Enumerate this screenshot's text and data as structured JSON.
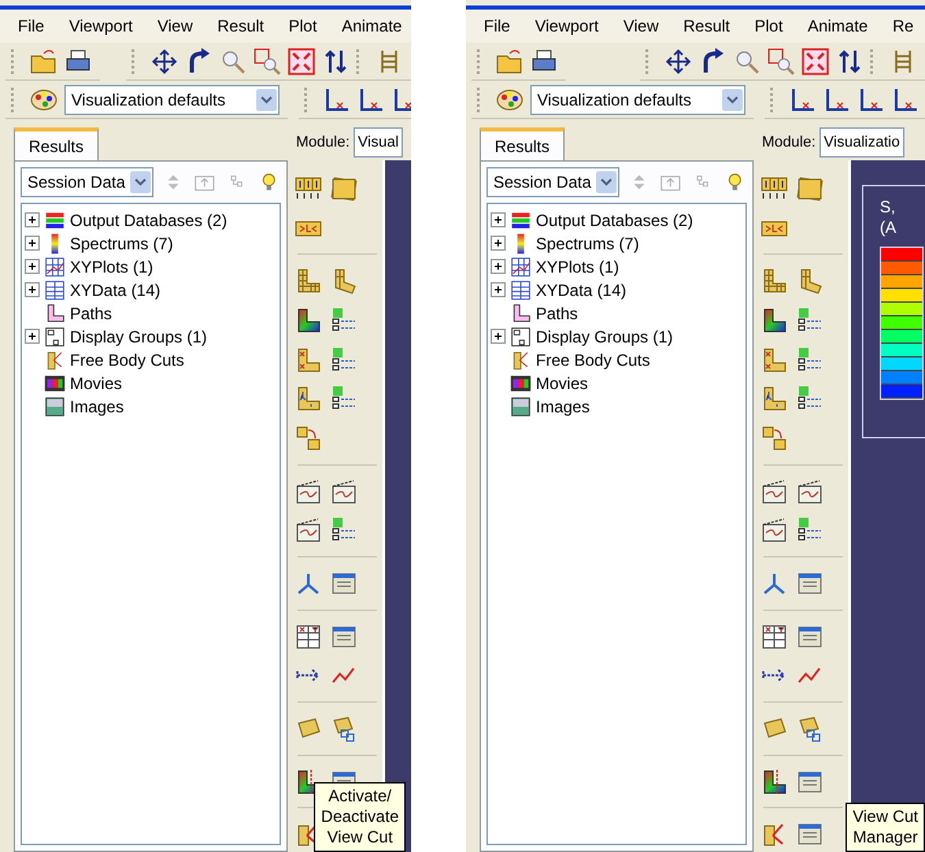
{
  "panels": [
    {
      "menu": [
        "File",
        "Viewport",
        "View",
        "Result",
        "Plot",
        "Animate"
      ],
      "style_combo": "Visualization defaults",
      "tabs": [
        {
          "label": "Results",
          "selected": true
        }
      ],
      "session_combo": "Session Data",
      "module_label": "Module:",
      "module_value": "Visual",
      "tree": [
        {
          "label": "Output Databases (2)",
          "kind": "odb",
          "expandable": true
        },
        {
          "label": "Spectrums (7)",
          "kind": "spectrum",
          "expandable": true
        },
        {
          "label": "XYPlots (1)",
          "kind": "xyplot",
          "expandable": true
        },
        {
          "label": "XYData (14)",
          "kind": "xydata",
          "expandable": true
        },
        {
          "label": "Paths",
          "kind": "path",
          "expandable": false
        },
        {
          "label": "Display Groups (1)",
          "kind": "group",
          "expandable": true
        },
        {
          "label": "Free Body Cuts",
          "kind": "cut",
          "expandable": false
        },
        {
          "label": "Movies",
          "kind": "movie",
          "expandable": false
        },
        {
          "label": "Images",
          "kind": "image",
          "expandable": false
        }
      ],
      "tooltip": [
        "Activate/",
        "Deactivate",
        "View Cut"
      ]
    },
    {
      "menu": [
        "File",
        "Viewport",
        "View",
        "Result",
        "Plot",
        "Animate",
        "Re"
      ],
      "style_combo": "Visualization defaults",
      "tabs": [
        {
          "label": "Results",
          "selected": true
        }
      ],
      "session_combo": "Session Data",
      "module_label": "Module:",
      "module_value": "Visualizatio",
      "tree": [
        {
          "label": "Output Databases (2)",
          "kind": "odb",
          "expandable": true
        },
        {
          "label": "Spectrums (7)",
          "kind": "spectrum",
          "expandable": true
        },
        {
          "label": "XYPlots (1)",
          "kind": "xyplot",
          "expandable": true
        },
        {
          "label": "XYData (14)",
          "kind": "xydata",
          "expandable": true
        },
        {
          "label": "Paths",
          "kind": "path",
          "expandable": false
        },
        {
          "label": "Display Groups (1)",
          "kind": "group",
          "expandable": true
        },
        {
          "label": "Free Body Cuts",
          "kind": "cut",
          "expandable": false
        },
        {
          "label": "Movies",
          "kind": "movie",
          "expandable": false
        },
        {
          "label": "Images",
          "kind": "image",
          "expandable": false
        }
      ],
      "legend": {
        "title": [
          "S,",
          "(A"
        ]
      },
      "tooltip": [
        "View Cut",
        "Manager"
      ]
    }
  ]
}
